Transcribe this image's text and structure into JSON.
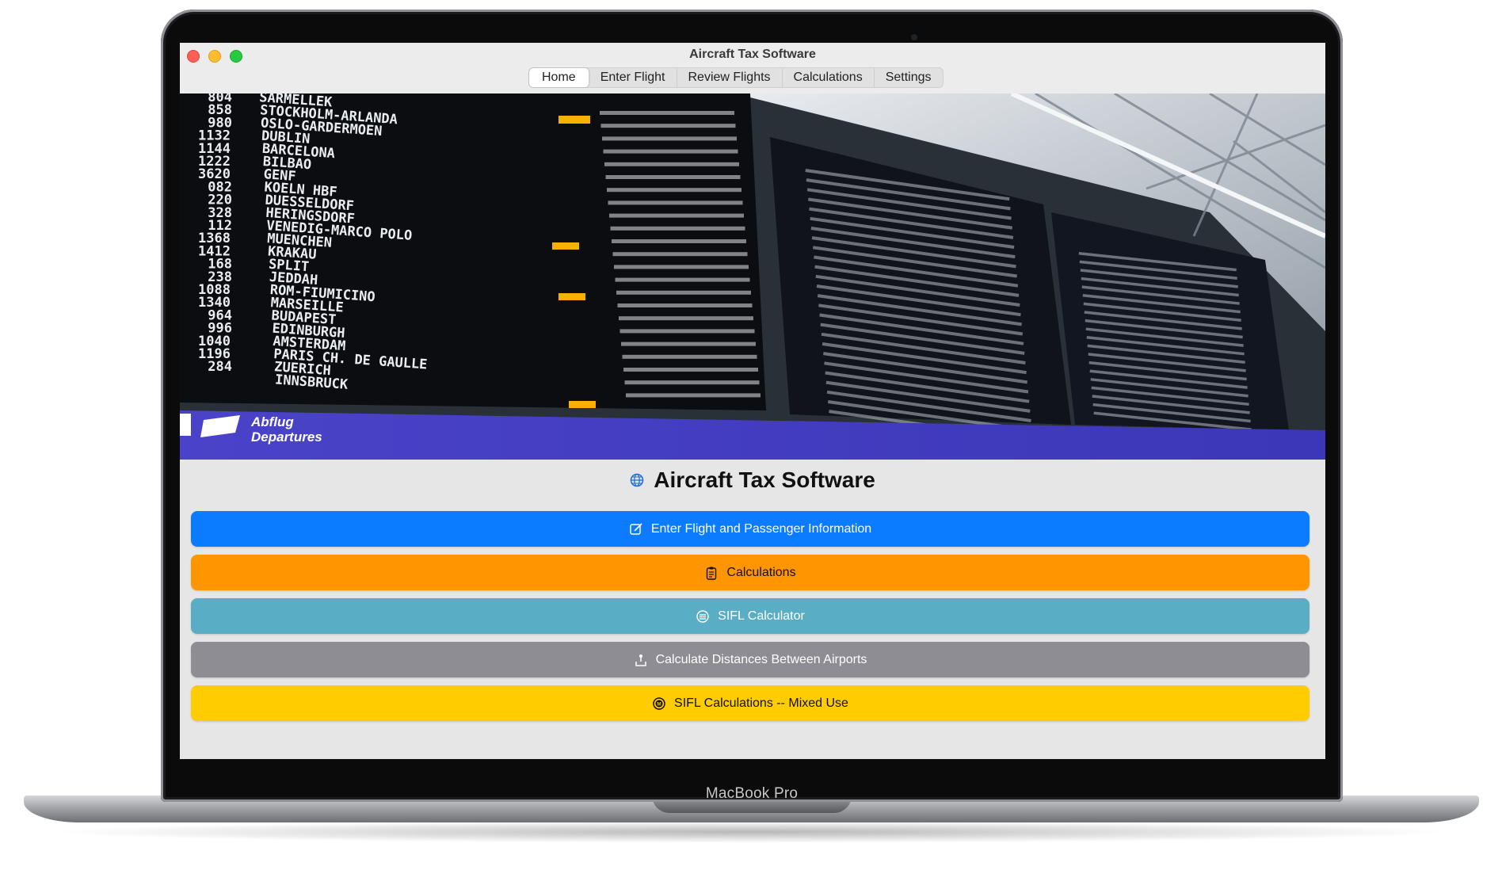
{
  "window": {
    "title": "Aircraft Tax Software"
  },
  "tabs": [
    "Home",
    "Enter Flight",
    "Review Flights",
    "Calculations",
    "Settings"
  ],
  "banner": {
    "sign_line1": "Abflug",
    "sign_line2": "Departures",
    "board_rows": [
      {
        "flight": "804",
        "dest": "SARMELLEK"
      },
      {
        "flight": "858",
        "dest": "STOCKHOLM-ARLANDA"
      },
      {
        "flight": "980",
        "dest": "OSLO-GARDERMOEN"
      },
      {
        "flight": "1132",
        "dest": "DUBLIN"
      },
      {
        "flight": "1144",
        "dest": "BARCELONA"
      },
      {
        "flight": "1222",
        "dest": "BILBAO"
      },
      {
        "flight": "3620",
        "dest": "GENF"
      },
      {
        "flight": "082",
        "dest": "KOELN HBF"
      },
      {
        "flight": "220",
        "dest": "DUESSELDORF"
      },
      {
        "flight": "328",
        "dest": "HERINGSDORF"
      },
      {
        "flight": "112",
        "dest": "VENEDIG-MARCO POLO"
      },
      {
        "flight": "1368",
        "dest": "MUENCHEN"
      },
      {
        "flight": "1412",
        "dest": "KRAKAU"
      },
      {
        "flight": "168",
        "dest": "SPLIT"
      },
      {
        "flight": "238",
        "dest": "JEDDAH"
      },
      {
        "flight": "1088",
        "dest": "ROM-FIUMICINO"
      },
      {
        "flight": "1340",
        "dest": "MARSEILLE"
      },
      {
        "flight": "964",
        "dest": "BUDAPEST"
      },
      {
        "flight": "996",
        "dest": "EDINBURGH"
      },
      {
        "flight": "1040",
        "dest": "AMSTERDAM"
      },
      {
        "flight": "1196",
        "dest": "PARIS CH. DE GAULLE"
      },
      {
        "flight": "284",
        "dest": "ZUERICH"
      },
      {
        "flight": "",
        "dest": "INNSBRUCK"
      }
    ]
  },
  "main": {
    "heading": "Aircraft Tax Software",
    "heading_icon": "globe-icon",
    "buttons": [
      {
        "label": "Enter Flight and Passenger Information",
        "icon": "square-pencil-icon",
        "color": "#0b7cff"
      },
      {
        "label": "Calculations",
        "icon": "clipboard-icon",
        "color": "#ff9500"
      },
      {
        "label": "SIFL Calculator",
        "icon": "stack-circle-icon",
        "color": "#59adc5"
      },
      {
        "label": "Calculate Distances Between Airports",
        "icon": "pin-tray-icon",
        "color": "#8e8d93"
      },
      {
        "label": "SIFL Calculations -- Mixed Use",
        "icon": "m-circle-icon",
        "color": "#ffcc00"
      }
    ]
  },
  "device": {
    "brand": "MacBook Pro"
  }
}
